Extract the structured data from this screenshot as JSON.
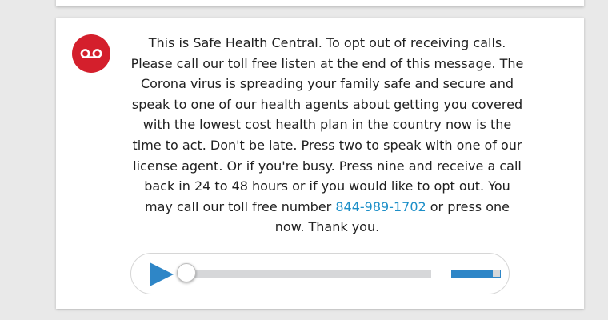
{
  "voicemail": {
    "icon": "voicemail-icon",
    "icon_color": "#d41f2c",
    "message_text": "This is Safe Health Central. To opt out of receiving calls. Please call our toll free listen at the end of this message. The Corona virus is spreading your family safe and secure and speak to one of our health agents about getting you covered with the lowest cost health plan in the country now is the time to act. Don't be late. Press two to speak with one of our license agent. Or if you're busy. Press nine and receive a call back in 24 to 48 hours or if you would like to opt out. You may call our toll free number",
    "phone_number": "844-989-1702",
    "message_tail": "or press one now. Thank you.",
    "link_color": "#1d8fc8"
  },
  "player": {
    "play_icon": "play-icon",
    "accent_color": "#2e86c7",
    "progress": 0,
    "volume": 0.85
  }
}
